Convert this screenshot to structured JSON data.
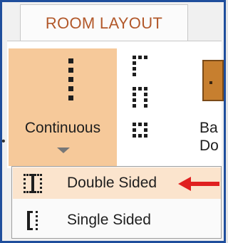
{
  "ribbon": {
    "tab_label": "ROOM LAYOUT",
    "continuous_label": "Continuous",
    "door_label_line1": "Ba",
    "door_label_line2": "Do"
  },
  "dropdown": {
    "items": [
      {
        "label": "Double Sided",
        "highlighted": true
      },
      {
        "label": "Single Sided",
        "highlighted": false
      }
    ]
  },
  "colors": {
    "frame_border": "#1f4e9c",
    "tab_text": "#b2582a",
    "selected_button": "#f6c99a",
    "highlight_row": "#fbe4cd",
    "annotation_arrow": "#e02020"
  },
  "icons": [
    "dotted-line-icon",
    "corner-layout-icon",
    "u-layout-icon",
    "box-layout-icon",
    "door-icon",
    "dropdown-arrow-icon",
    "double-sided-icon",
    "single-sided-icon",
    "red-arrow-annotation"
  ]
}
